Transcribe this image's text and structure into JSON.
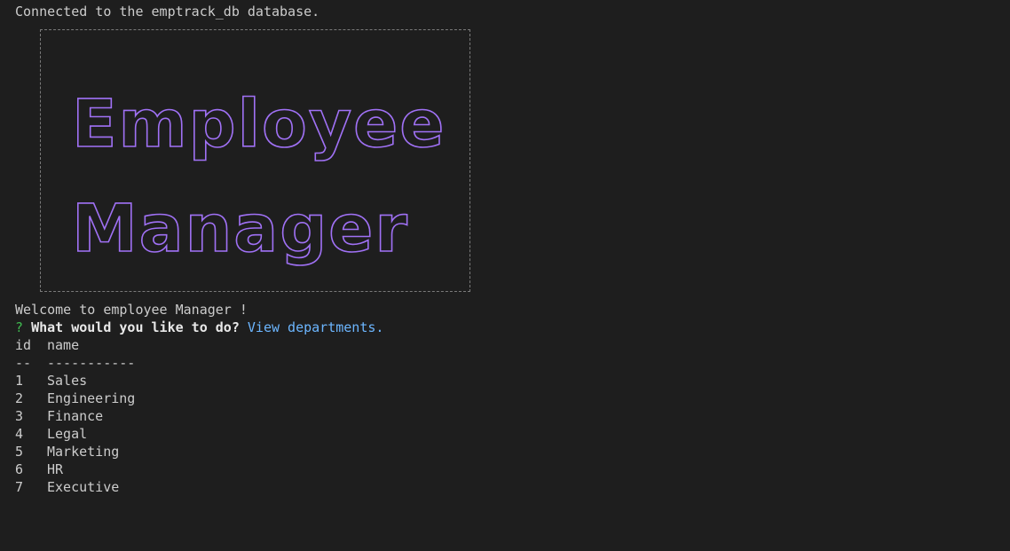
{
  "status_message": "Connected to the emptrack_db database.",
  "banner": {
    "line1": "Employee",
    "line2": "Manager",
    "color": "#a071f5"
  },
  "welcome": "Welcome to employee Manager !",
  "prompt": {
    "marker": "?",
    "question": "What would you like to do?",
    "answer": "View departments."
  },
  "table": {
    "headers": [
      "id",
      "name"
    ],
    "separators": [
      "--",
      "-----------"
    ],
    "rows": [
      {
        "id": "1",
        "name": "Sales"
      },
      {
        "id": "2",
        "name": "Engineering"
      },
      {
        "id": "3",
        "name": "Finance"
      },
      {
        "id": "4",
        "name": "Legal"
      },
      {
        "id": "5",
        "name": "Marketing"
      },
      {
        "id": "6",
        "name": "HR"
      },
      {
        "id": "7",
        "name": "Executive"
      }
    ]
  }
}
